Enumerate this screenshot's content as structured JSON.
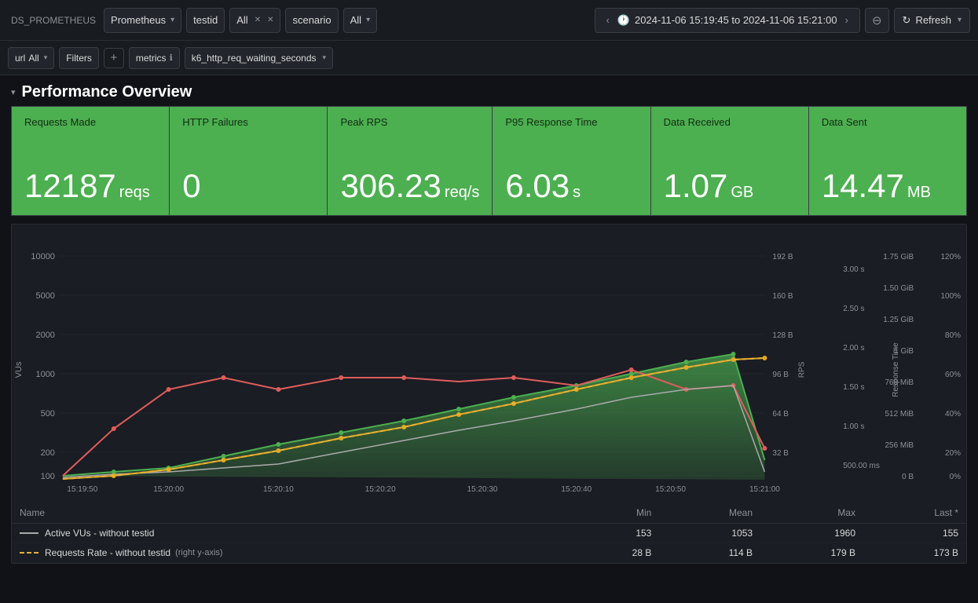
{
  "toolbar": {
    "ds_label": "DS_PROMETHEUS",
    "datasource": "Prometheus",
    "testid_label": "testid",
    "all_label1": "All",
    "scenario_label": "scenario",
    "all_label2": "All",
    "nav_left": "‹",
    "nav_right": "›",
    "time_range": "2024-11-06 15:19:45 to 2024-11-06 15:21:00",
    "zoom_icon": "⊖",
    "refresh_label": "Refresh",
    "refresh_icon": "↻"
  },
  "filterbar": {
    "url_label": "url",
    "url_value": "All",
    "filters_label": "Filters",
    "add_icon": "+",
    "metrics_label": "metrics",
    "info_icon": "ℹ",
    "metrics_value": "k6_http_req_waiting_seconds"
  },
  "section": {
    "title": "Performance Overview",
    "collapse_icon": "▾"
  },
  "stats": [
    {
      "label": "Requests Made",
      "value": "12187",
      "unit": "reqs"
    },
    {
      "label": "HTTP Failures",
      "value": "0",
      "unit": ""
    },
    {
      "label": "Peak RPS",
      "value": "306.23",
      "unit": "req/s"
    },
    {
      "label": "P95 Response Time",
      "value": "6.03",
      "unit": "s"
    },
    {
      "label": "Data Received",
      "value": "1.07",
      "unit": "GB"
    },
    {
      "label": "Data Sent",
      "value": "14.47",
      "unit": "MB"
    }
  ],
  "chart": {
    "x_label": "VUs",
    "y_left_label": "VUs",
    "y_right_label1": "RPS",
    "y_right_label2": "Response Time",
    "x_ticks": [
      "15:19:50",
      "15:20:00",
      "15:20:10",
      "15:20:20",
      "15:20:30",
      "15:20:40",
      "15:20:50",
      "15:21:00"
    ],
    "y_left_ticks": [
      "100",
      "200",
      "500",
      "1000",
      "2000",
      "5000",
      "10000"
    ],
    "y_right_ticks_rps": [
      "192 B",
      "160 B",
      "128 B",
      "96 B",
      "64 B",
      "32 B"
    ],
    "y_right_ticks_resp": [
      "1.75 GiB",
      "1.50 GiB",
      "1.25 GiB",
      "1 GiB",
      "768 MiB",
      "512 MiB",
      "256 MiB",
      "0 B"
    ],
    "y_right_ticks_pct": [
      "120%",
      "100%",
      "80%",
      "60%",
      "40%",
      "20%",
      "0%"
    ],
    "y_resp_ticks": [
      "3.00 s",
      "2.50 s",
      "2.00 s",
      "1.50 s",
      "1.00 s",
      "500.00 ms"
    ],
    "accent_color": "#4caf50"
  },
  "legend": {
    "headers": [
      "Name",
      "Min",
      "Mean",
      "Max",
      "Last *"
    ],
    "rows": [
      {
        "name": "Active VUs - without testid",
        "color": "#aaaaaa",
        "dashed": false,
        "note": "",
        "min": "153",
        "mean": "1053",
        "max": "1960",
        "last": "155"
      },
      {
        "name": "Requests Rate - without testid",
        "color": "#e6b238",
        "dashed": true,
        "note": "(right y-axis)",
        "min": "28 B",
        "mean": "114 B",
        "max": "179 B",
        "last": "173 B"
      }
    ]
  }
}
